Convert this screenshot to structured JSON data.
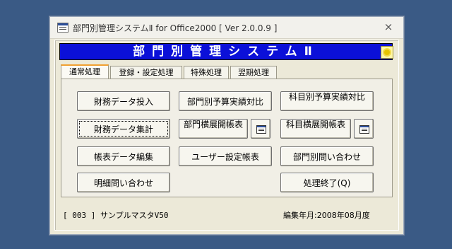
{
  "window": {
    "title": "部門別管理システムⅡ for Office2000 [ Ver 2.0.0.9 ]",
    "close_symbol": "×"
  },
  "banner": {
    "text": "部門別管理システムⅡ"
  },
  "tabs": [
    {
      "label": "通常処理",
      "active": true
    },
    {
      "label": "登録・設定処理",
      "active": false
    },
    {
      "label": "特殊処理",
      "active": false
    },
    {
      "label": "翌期処理",
      "active": false
    }
  ],
  "buttons": {
    "zaimu_input": "財務データ投入",
    "zaimu_sum": "財務データ集計",
    "report_edit": "帳表データ編集",
    "detail_inquiry": "明細問い合わせ",
    "dept_budget": "部門別予算実績対比",
    "dept_cross": "部門横展開帳表",
    "user_setting": "ユーザー設定帳表",
    "item_budget": "科目別予算実績対比",
    "item_cross": "科目横展開帳表",
    "dept_inquiry": "部門別問い合わせ",
    "exit": "処理終了(Q)"
  },
  "status": {
    "company": "[ 003 ] サンプルマスタV50",
    "edit_month": "編集年月:2008年08月度"
  },
  "icons": {
    "app": "form-icon",
    "banner": "lightbulb-icon",
    "mini": "form-icon"
  }
}
